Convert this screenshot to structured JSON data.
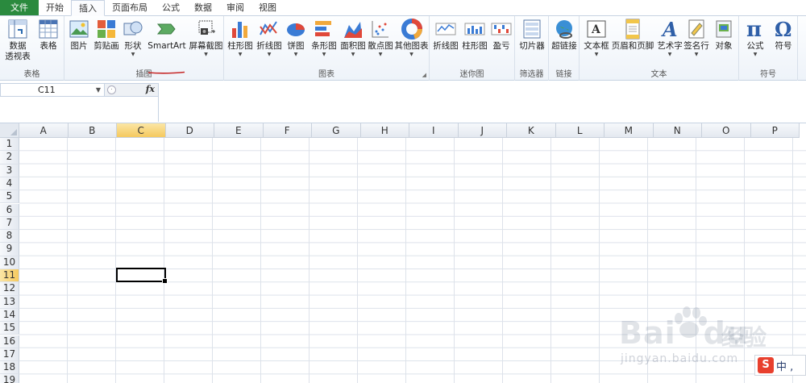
{
  "menu": {
    "tabs": [
      "文件",
      "开始",
      "插入",
      "页面布局",
      "公式",
      "数据",
      "审阅",
      "视图"
    ],
    "active_tab": "插入"
  },
  "ribbon": {
    "groups": [
      {
        "label": "表格",
        "buttons": [
          "数据\n透视表",
          "表格"
        ]
      },
      {
        "label": "插图",
        "buttons": [
          "图片",
          "剪贴画",
          "形状",
          "SmartArt",
          "屏幕截图"
        ]
      },
      {
        "label": "图表",
        "buttons": [
          "柱形图",
          "折线图",
          "饼图",
          "条形图",
          "面积图",
          "散点图",
          "其他图表"
        ]
      },
      {
        "label": "迷你图",
        "buttons": [
          "折线图",
          "柱形图",
          "盈亏"
        ]
      },
      {
        "label": "筛选器",
        "buttons": [
          "切片器"
        ]
      },
      {
        "label": "链接",
        "buttons": [
          "超链接"
        ]
      },
      {
        "label": "文本",
        "buttons": [
          "文本框",
          "页眉和页脚",
          "艺术字",
          "签名行",
          "对象"
        ]
      },
      {
        "label": "符号",
        "buttons": [
          "公式",
          "符号"
        ]
      }
    ],
    "pivot_line1": "数据",
    "pivot_line2": "透视表",
    "highlight_color": "#c62828"
  },
  "formula_bar": {
    "name_box": "C11",
    "fx": "fx",
    "formula": ""
  },
  "sheet": {
    "columns": [
      "A",
      "B",
      "C",
      "D",
      "E",
      "F",
      "G",
      "H",
      "I",
      "J",
      "K",
      "L",
      "M",
      "N",
      "O",
      "P"
    ],
    "rows": [
      "1",
      "2",
      "3",
      "4",
      "5",
      "6",
      "7",
      "8",
      "9",
      "10",
      "11",
      "12",
      "13",
      "14",
      "15",
      "16",
      "17",
      "18",
      "19"
    ],
    "selected_column": "C",
    "selected_row": "11",
    "selection_color": "#f5c95e"
  },
  "watermark": {
    "brand": "Bai",
    "brand2": "du",
    "cn": "经验",
    "url": "jingyan.baidu.com"
  },
  "ime": {
    "logo": "S",
    "text": "中 ,"
  }
}
